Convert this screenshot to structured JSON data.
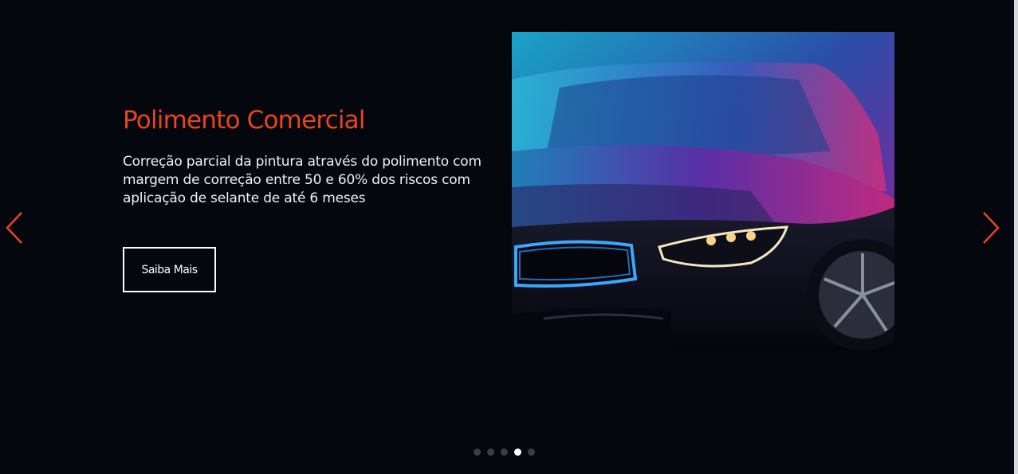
{
  "slide": {
    "title": "Polimento Comercial",
    "description": "Correção parcial da pintura através do polimento com margem de correção entre 50 e 60% dos riscos com aplicação de selante de até 6 meses",
    "button_label": "Saiba Mais",
    "image_icon": "car-photo"
  },
  "navigation": {
    "prev_icon": "chevron-left-icon",
    "next_icon": "chevron-right-icon",
    "dot_count": 5,
    "active_dot": 4
  },
  "colors": {
    "background": "#05070f",
    "accent": "#e8451e",
    "text": "#f1f1f1",
    "dot_inactive": "#3a3d47",
    "dot_active": "#ffffff"
  }
}
